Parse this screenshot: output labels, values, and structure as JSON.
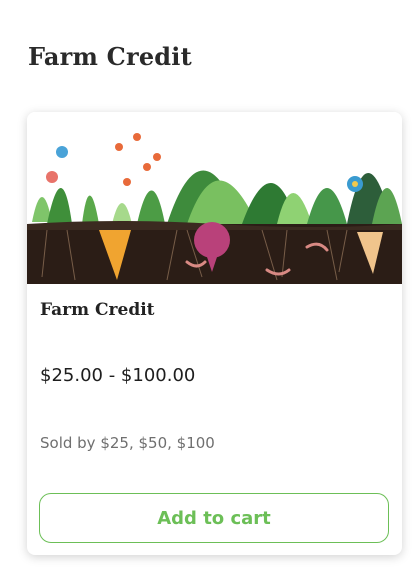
{
  "page": {
    "title": "Farm Credit"
  },
  "product": {
    "name": "Farm Credit",
    "price": "$25.00 - $100.00",
    "sold_by": "Sold by $25, $50, $100",
    "add_to_cart_label": "Add to cart",
    "image_icon": "vegetable-garden-illustration",
    "accent_color": "#6cbf57"
  }
}
